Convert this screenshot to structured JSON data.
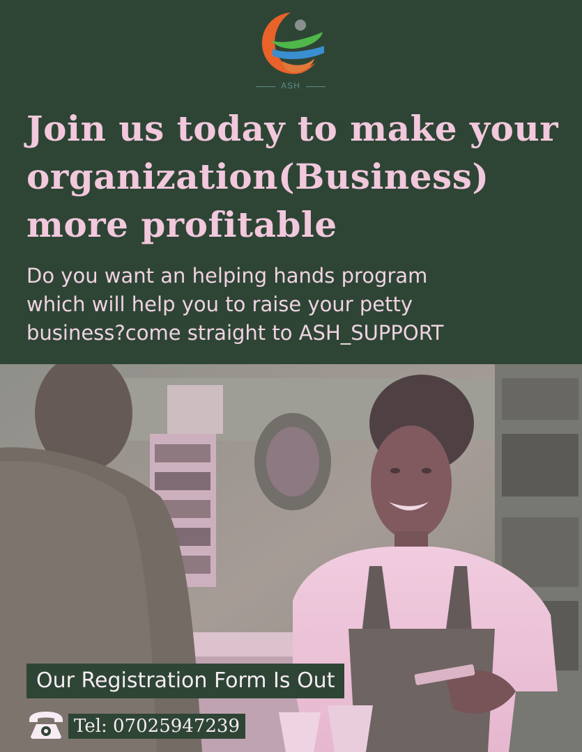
{
  "brand": {
    "logo_text": "ASH"
  },
  "headline": {
    "line1": "Join us today to make your",
    "line2": "organization(Business)",
    "line3": "more profitable"
  },
  "subtext": {
    "line1": "Do you want an helping hands program",
    "line2": "which will help you to raise your petty",
    "line3": "business?come straight to ASH_SUPPORT"
  },
  "photo": {
    "icon": "shop-cashier-photo"
  },
  "cta": {
    "registration": "Our Registration Form Is Out"
  },
  "contact": {
    "icon": "phone-icon",
    "tel": "Tel: 07025947239"
  },
  "colors": {
    "background": "#2e4535",
    "headline": "#f2c8dc",
    "body_text": "#f0d3e2",
    "logo_orange": "#e8622a",
    "logo_green": "#4fb84a",
    "logo_blue": "#3a8fd1"
  }
}
